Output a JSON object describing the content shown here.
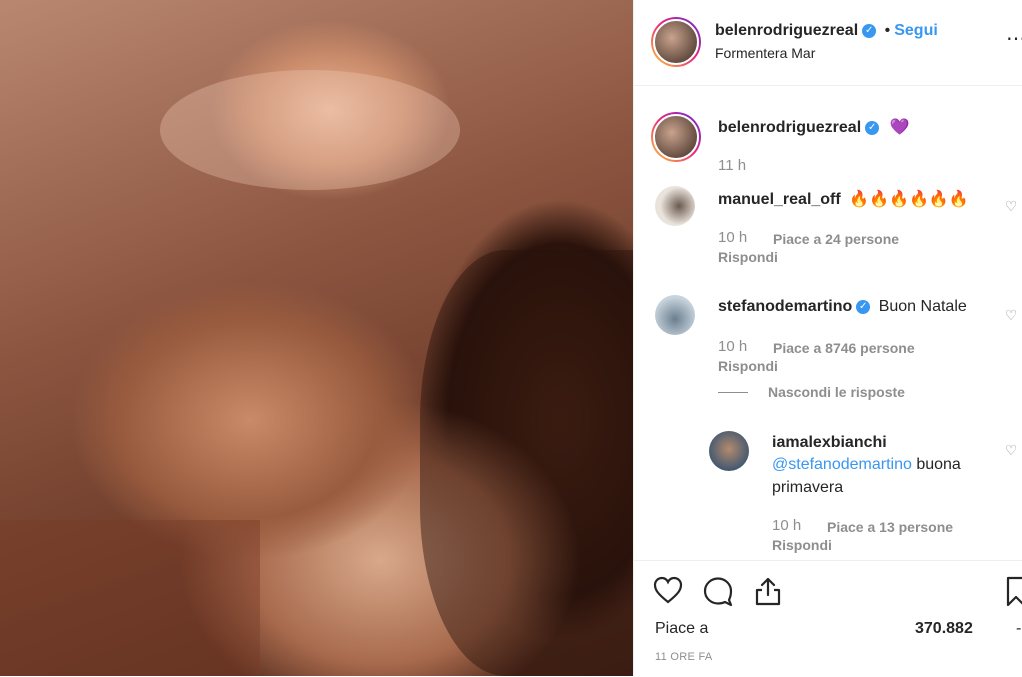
{
  "post": {
    "author": "belenrodriguezreal",
    "follow_label": "Segui",
    "location": "Formentera Mar",
    "caption_emoji": "💜",
    "caption_time": "11 h",
    "more_label": "⋯"
  },
  "comments": [
    {
      "user": "manuel_real_off",
      "text": "🔥🔥🔥🔥🔥🔥",
      "time": "10 h",
      "likes": "Piace a 24 persone",
      "reply": "Rispondi"
    },
    {
      "user": "stefanodemartino",
      "text": "Buon Natale",
      "time": "10 h",
      "likes": "Piace a 8746 persone",
      "reply": "Rispondi",
      "hide_replies": "Nascondi le risposte"
    }
  ],
  "reply": {
    "user": "iamalexbianchi",
    "mention": "@stefanodemartino",
    "text_rest": "buona",
    "text_line2": "primavera",
    "time": "10 h",
    "likes": "Piace a 13 persone",
    "reply": "Rispondi"
  },
  "footer": {
    "likes_label": "Piace a",
    "likes_count": "370.882",
    "age": "11 ORE FA",
    "dash": "-"
  },
  "colors": {
    "link": "#3897f0",
    "muted": "#8e8e8e",
    "text": "#262626"
  },
  "icons": [
    "verified-icon",
    "heart-icon",
    "comment-icon",
    "share-icon",
    "bookmark-icon",
    "more-icon"
  ]
}
